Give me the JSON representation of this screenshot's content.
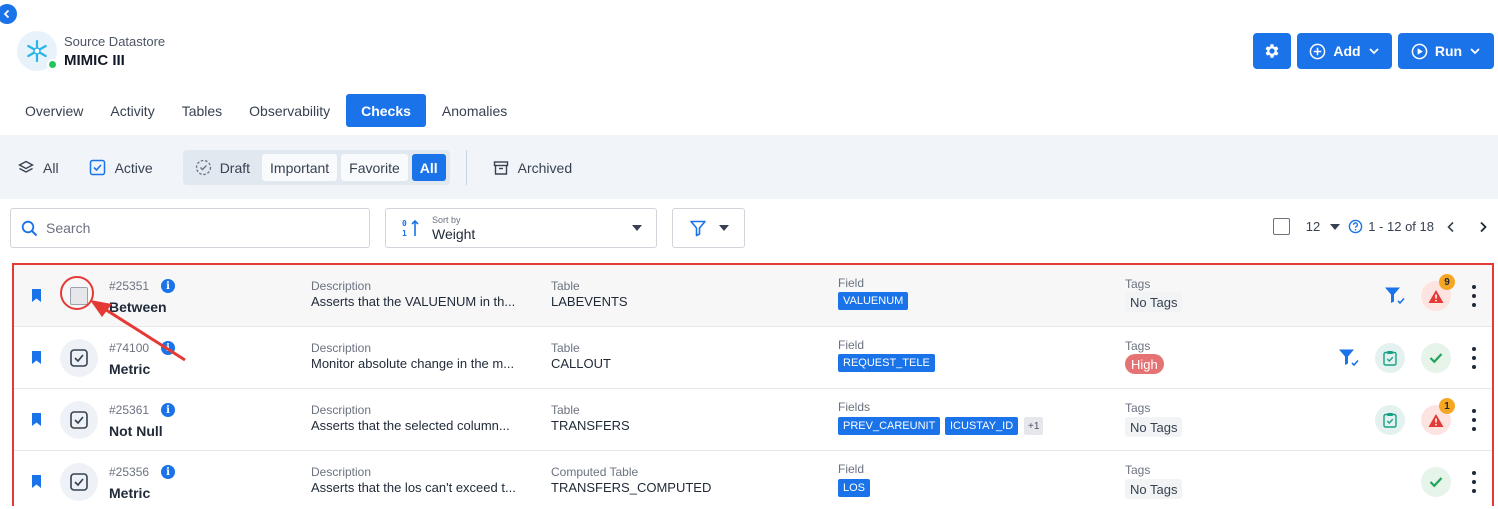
{
  "header": {
    "subtitle": "Source Datastore",
    "title": "MIMIC III"
  },
  "actions": {
    "add_label": "Add",
    "run_label": "Run"
  },
  "tabs": [
    {
      "label": "Overview"
    },
    {
      "label": "Activity"
    },
    {
      "label": "Tables"
    },
    {
      "label": "Observability"
    },
    {
      "label": "Checks",
      "active": true
    },
    {
      "label": "Anomalies"
    }
  ],
  "status_filter": {
    "all": "All",
    "active": "Active",
    "draft": "Draft",
    "important": "Important",
    "favorite": "Favorite",
    "all_pill": "All",
    "archived": "Archived"
  },
  "search": {
    "placeholder": "Search"
  },
  "sort": {
    "caption": "Sort by",
    "value": "Weight"
  },
  "pager": {
    "per_page": "12",
    "range": "1 - 12 of 18"
  },
  "rows": [
    {
      "id": "#25351",
      "type": "Between",
      "desc_label": "Description",
      "desc": "Asserts that the VALUENUM in th...",
      "table_label": "Table",
      "table": "LABEVENTS",
      "field_label": "Field",
      "fields": [
        "VALUENUM"
      ],
      "tags_label": "Tags",
      "tags": "No Tags",
      "anomaly_count": "9"
    },
    {
      "id": "#74100",
      "type": "Metric",
      "desc_label": "Description",
      "desc": "Monitor absolute change in the m...",
      "table_label": "Table",
      "table": "CALLOUT",
      "field_label": "Field",
      "fields": [
        "REQUEST_TELE"
      ],
      "tags_label": "Tags",
      "tags": "High"
    },
    {
      "id": "#25361",
      "type": "Not Null",
      "desc_label": "Description",
      "desc": "Asserts that the selected column...",
      "table_label": "Table",
      "table": "TRANSFERS",
      "field_label": "Fields",
      "fields": [
        "PREV_CAREUNIT",
        "ICUSTAY_ID"
      ],
      "more": "+1",
      "tags_label": "Tags",
      "tags": "No Tags",
      "anomaly_count": "1"
    },
    {
      "id": "#25356",
      "type": "Metric",
      "desc_label": "Description",
      "desc": "Asserts that the los can't exceed t...",
      "table_label": "Computed Table",
      "table": "TRANSFERS_COMPUTED",
      "field_label": "Field",
      "fields": [
        "LOS"
      ],
      "tags_label": "Tags",
      "tags": "No Tags"
    }
  ],
  "colors": {
    "primary": "#1a73e8",
    "annotation": "#e53935",
    "high_tag": "#e57373"
  }
}
